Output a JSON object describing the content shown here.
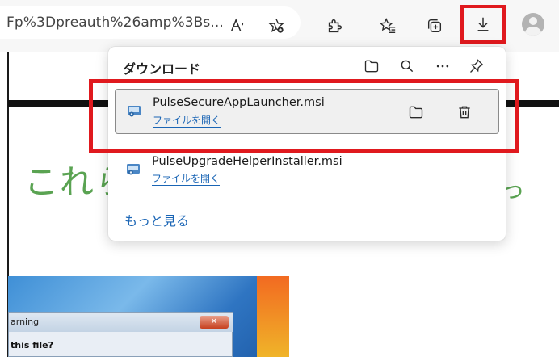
{
  "toolbar": {
    "url_text": "Fp%3Dpreauth%26amp%3Bs...",
    "read_aloud_icon": "read-aloud-icon",
    "favorite_add_icon": "add-favorite-icon",
    "extensions_icon": "extensions-icon",
    "favorites_icon": "favorites-icon",
    "collections_icon": "collections-icon",
    "download_icon": "download-icon",
    "profile_icon": "avatar",
    "highlight_color": "#e0191e"
  },
  "page": {
    "green_text": "これら",
    "green_text_right": "っ",
    "green_color": "#5aa352",
    "dialog": {
      "title": "arning",
      "question": "this file?"
    }
  },
  "downloads": {
    "title": "ダウンロード",
    "header_icons": [
      "folder-icon",
      "search-icon",
      "more-icon",
      "pin-icon"
    ],
    "items": [
      {
        "file_name": "PulseSecureAppLauncher.msi",
        "action_label": "ファイルを開く",
        "selected": true
      },
      {
        "file_name": "PulseUpgradeHelperInstaller.msi",
        "action_label": "ファイルを開く",
        "selected": false
      }
    ],
    "see_more_label": "もっと見る",
    "link_color": "#1a65b5"
  }
}
